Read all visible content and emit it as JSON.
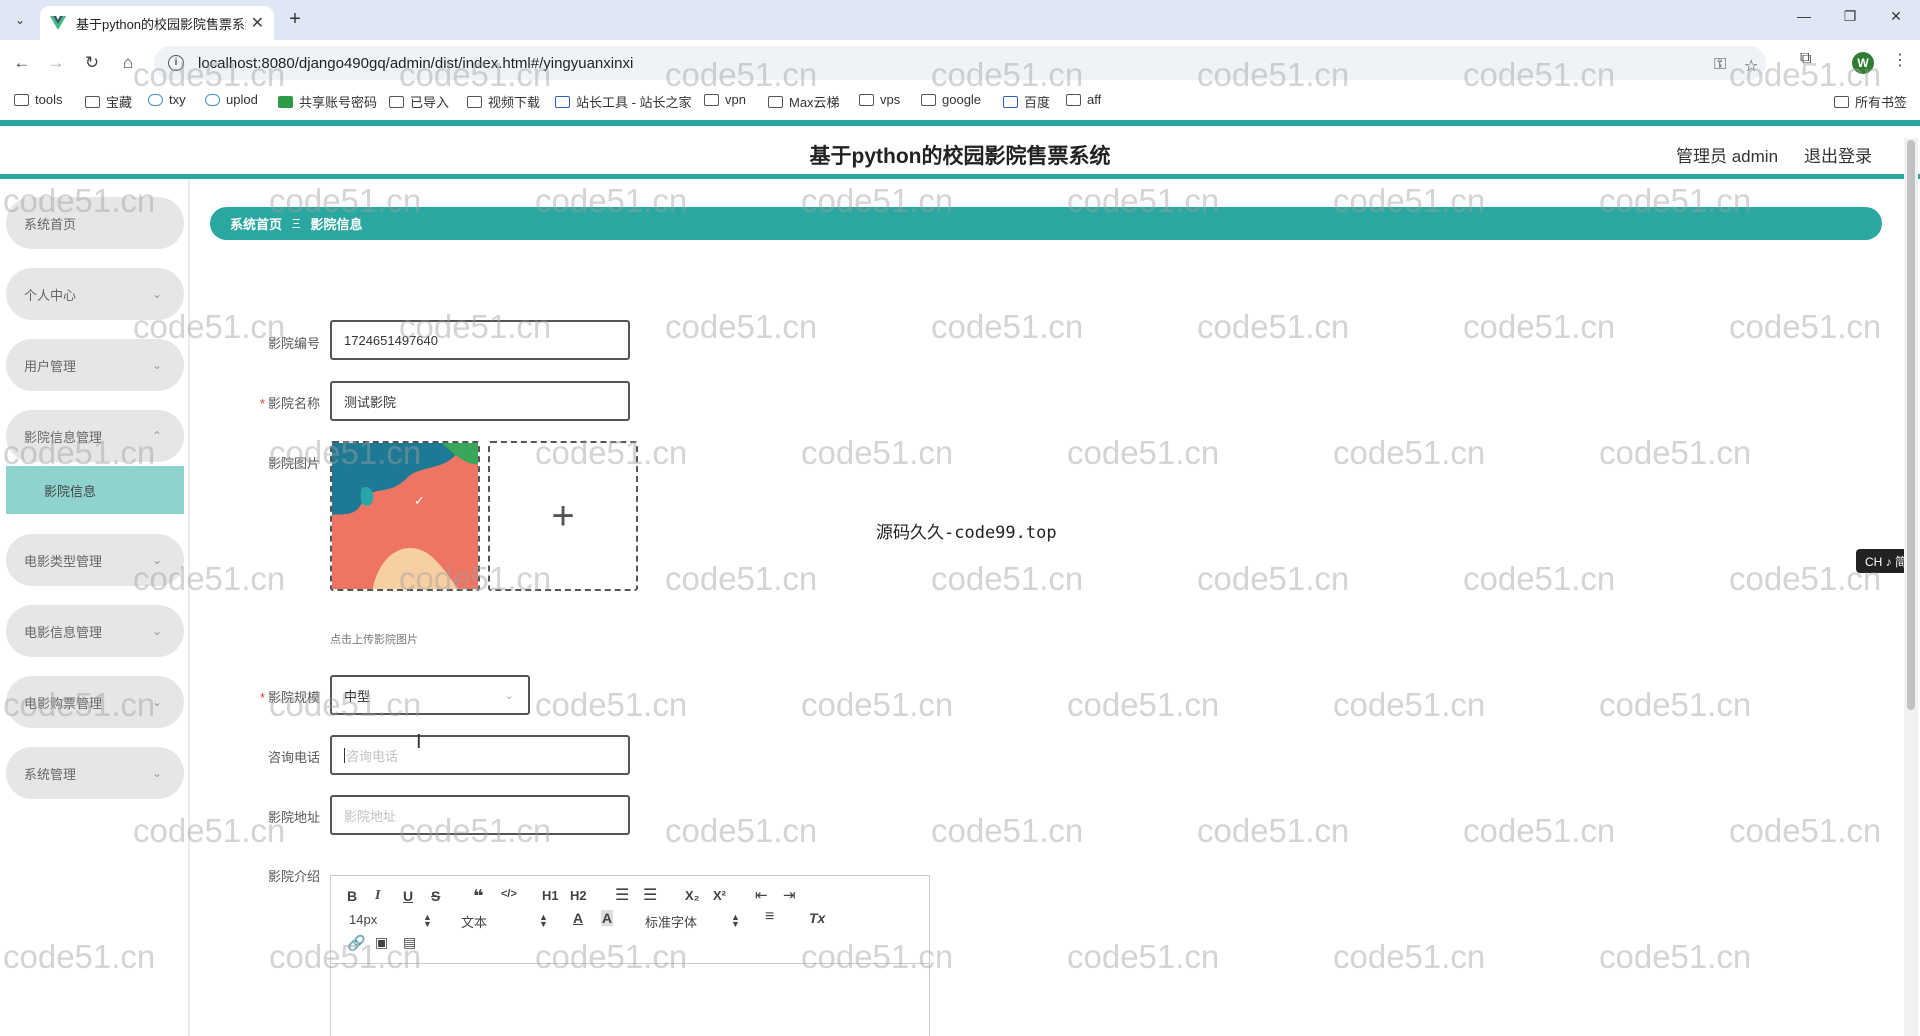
{
  "browser": {
    "tab_title": "基于python的校园影院售票系统",
    "url": "localhost:8080/django490gq/admin/dist/index.html#/yingyuanxinxi",
    "profile_initial": "W",
    "bookmarks": [
      "tools",
      "宝藏",
      "txy",
      "uplod",
      "共享账号密码",
      "已导入",
      "视频下载",
      "站长工具 - 站长之家",
      "vpn",
      "Max云梯",
      "vps",
      "google",
      "百度",
      "aff"
    ],
    "all_bookmarks": "所有书签"
  },
  "header": {
    "title": "基于python的校园影院售票系统",
    "admin_label": "管理员 admin",
    "logout": "退出登录"
  },
  "sidebar": {
    "items": [
      {
        "label": "系统首页",
        "expandable": false
      },
      {
        "label": "个人中心",
        "expandable": true
      },
      {
        "label": "用户管理",
        "expandable": true
      },
      {
        "label": "影院信息管理",
        "expandable": true,
        "expanded": true
      },
      {
        "label": "电影类型管理",
        "expandable": true
      },
      {
        "label": "电影信息管理",
        "expandable": true
      },
      {
        "label": "电影购票管理",
        "expandable": true
      },
      {
        "label": "系统管理",
        "expandable": true
      }
    ],
    "active_sub": "影院信息"
  },
  "breadcrumb": {
    "home": "系统首页",
    "separator": "Ξ",
    "current": "影院信息"
  },
  "form": {
    "cinema_no": {
      "label": "影院编号",
      "value": "1724651497640"
    },
    "cinema_name": {
      "label": "影院名称",
      "value": "测试影院",
      "required_mark": "*"
    },
    "cinema_image": {
      "label": "影院图片",
      "hint": "点击上传影院图片",
      "upload_symbol": "+"
    },
    "scale": {
      "label": "影院规模",
      "value": "中型",
      "required_mark": "*"
    },
    "phone": {
      "label": "咨询电话",
      "placeholder": "咨询电话"
    },
    "address": {
      "label": "影院地址",
      "placeholder": "影院地址"
    },
    "intro": {
      "label": "影院介绍"
    }
  },
  "editor": {
    "font_size": "14px",
    "text_type": "文本",
    "font_family": "标准字体",
    "buttons": [
      "B",
      "I",
      "U",
      "S",
      "❝",
      "</>",
      "H1",
      "H2",
      "ordered-list",
      "bullet-list",
      "X₂",
      "X²",
      "outdent",
      "indent",
      "A",
      "A",
      "align",
      "Tx",
      "link",
      "image",
      "video"
    ]
  },
  "center_note": "源码久久-code99.top",
  "ime": "CH ♪ 简",
  "watermark": "code51.cn",
  "colors": {
    "accent": "#2aa7a0",
    "submenu_active": "#8fd3cf",
    "menu_bg": "#e6e6e6"
  }
}
